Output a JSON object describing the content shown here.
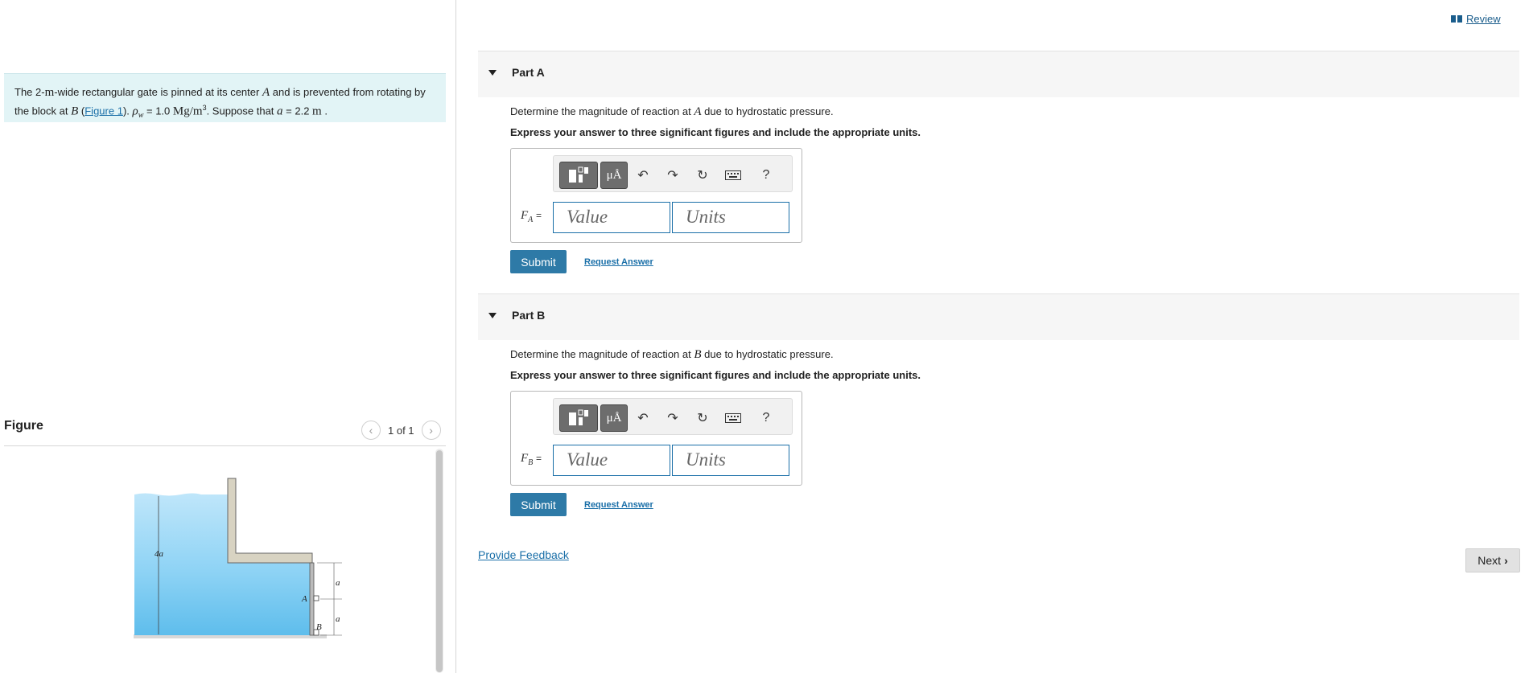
{
  "header": {
    "review_label": "Review"
  },
  "problem": {
    "text_1": "The 2-",
    "unit_m": "m",
    "text_2": "-wide rectangular gate is pinned at its center ",
    "var_A": "A",
    "text_3": " and is prevented from rotating by the block at ",
    "var_B": "B",
    "text_4": " (",
    "figure_link": "Figure 1",
    "text_5": "). ",
    "rho": "ρ",
    "rho_sub": "w",
    "text_6": " = 1.0 ",
    "density_unit": "Mg/m",
    "density_exp": "3",
    "text_7": ". Suppose that ",
    "var_a": "a",
    "text_8": " = 2.2 ",
    "len_unit": "m",
    "text_9": " ."
  },
  "figure": {
    "title": "Figure",
    "page": "1 of 1",
    "labels": {
      "depth": "4a",
      "pin": "A",
      "block": "B",
      "dim1": "a",
      "dim2": "a"
    }
  },
  "parts": [
    {
      "title": "Part A",
      "question_pre": "Determine the magnitude of reaction at ",
      "question_var": "A",
      "question_post": " due to hydrostatic pressure.",
      "instruction": "Express your answer to three significant figures and include the appropriate units.",
      "var": "F",
      "var_sub": "A",
      "equals": "=",
      "value_placeholder": "Value",
      "units_placeholder": "Units",
      "submit": "Submit",
      "request": "Request Answer"
    },
    {
      "title": "Part B",
      "question_pre": "Determine the magnitude of reaction at ",
      "question_var": "B",
      "question_post": " due to hydrostatic pressure.",
      "instruction": "Express your answer to three significant figures and include the appropriate units.",
      "var": "F",
      "var_sub": "B",
      "equals": "=",
      "value_placeholder": "Value",
      "units_placeholder": "Units",
      "submit": "Submit",
      "request": "Request Answer"
    }
  ],
  "toolbar": {
    "mu_label": "μÅ",
    "help_label": "?"
  },
  "footer": {
    "feedback": "Provide Feedback",
    "next": "Next"
  },
  "colors": {
    "accent": "#2e7aa7",
    "link": "#1a6fa8",
    "problem_bg": "#e2f4f6",
    "water": "#6cc4ef"
  }
}
